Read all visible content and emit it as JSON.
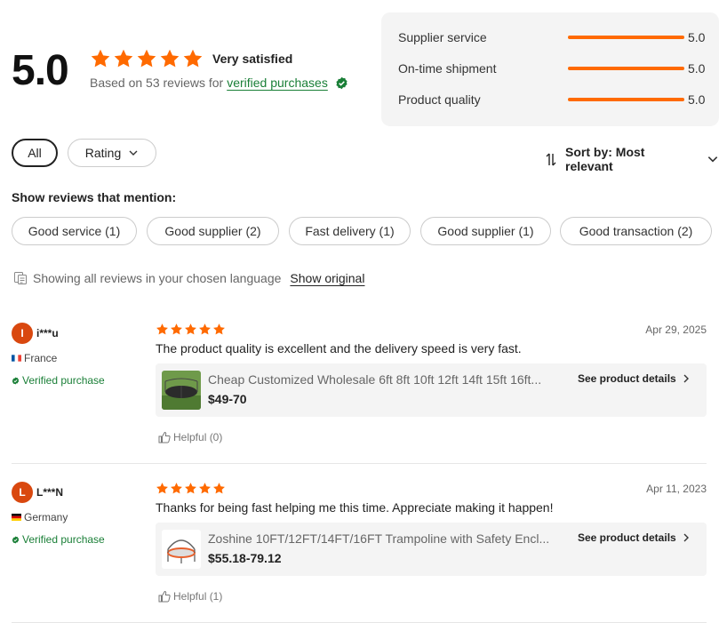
{
  "summary": {
    "score": "5.0",
    "satisfaction": "Very satisfied",
    "based_on": "Based on 53 reviews for",
    "verified_link": "verified purchases",
    "star_color": "#ff6a00",
    "metrics": [
      {
        "label": "Supplier service",
        "value": "5.0",
        "fraction": 1.0
      },
      {
        "label": "On-time shipment",
        "value": "5.0",
        "fraction": 1.0
      },
      {
        "label": "Product quality",
        "value": "5.0",
        "fraction": 1.0
      }
    ]
  },
  "filters": {
    "all_label": "All",
    "rating_label": "Rating",
    "sort_label": "Sort by: Most relevant"
  },
  "mentions": {
    "title": "Show reviews that mention:",
    "tags": [
      "Good service (1)",
      "Good supplier (2)",
      "Fast delivery (1)",
      "Good supplier (1)",
      "Good transaction (2)"
    ]
  },
  "language": {
    "note": "Showing all reviews in your chosen language",
    "show_original": "Show original"
  },
  "reviews": [
    {
      "initial": "I",
      "user": "i***u",
      "country": "France",
      "verified": "Verified purchase",
      "rating": 5,
      "date": "Apr 29, 2025",
      "text": "The product quality is excellent and the delivery speed is very fast.",
      "product_name": "Cheap Customized Wholesale 6ft 8ft 10ft 12ft 14ft 15ft 16ft...",
      "product_price": "$49-70",
      "product_link": "See product details",
      "helpful": "Helpful (0)"
    },
    {
      "initial": "L",
      "user": "L***N",
      "country": "Germany",
      "verified": "Verified purchase",
      "rating": 5,
      "date": "Apr 11, 2023",
      "text": "Thanks for being fast helping me this time. Appreciate making it happen!",
      "product_name": "Zoshine 10FT/12FT/14FT/16FT Trampoline with Safety Encl...",
      "product_price": "$55.18-79.12",
      "product_link": "See product details",
      "helpful": "Helpful (1)"
    }
  ]
}
